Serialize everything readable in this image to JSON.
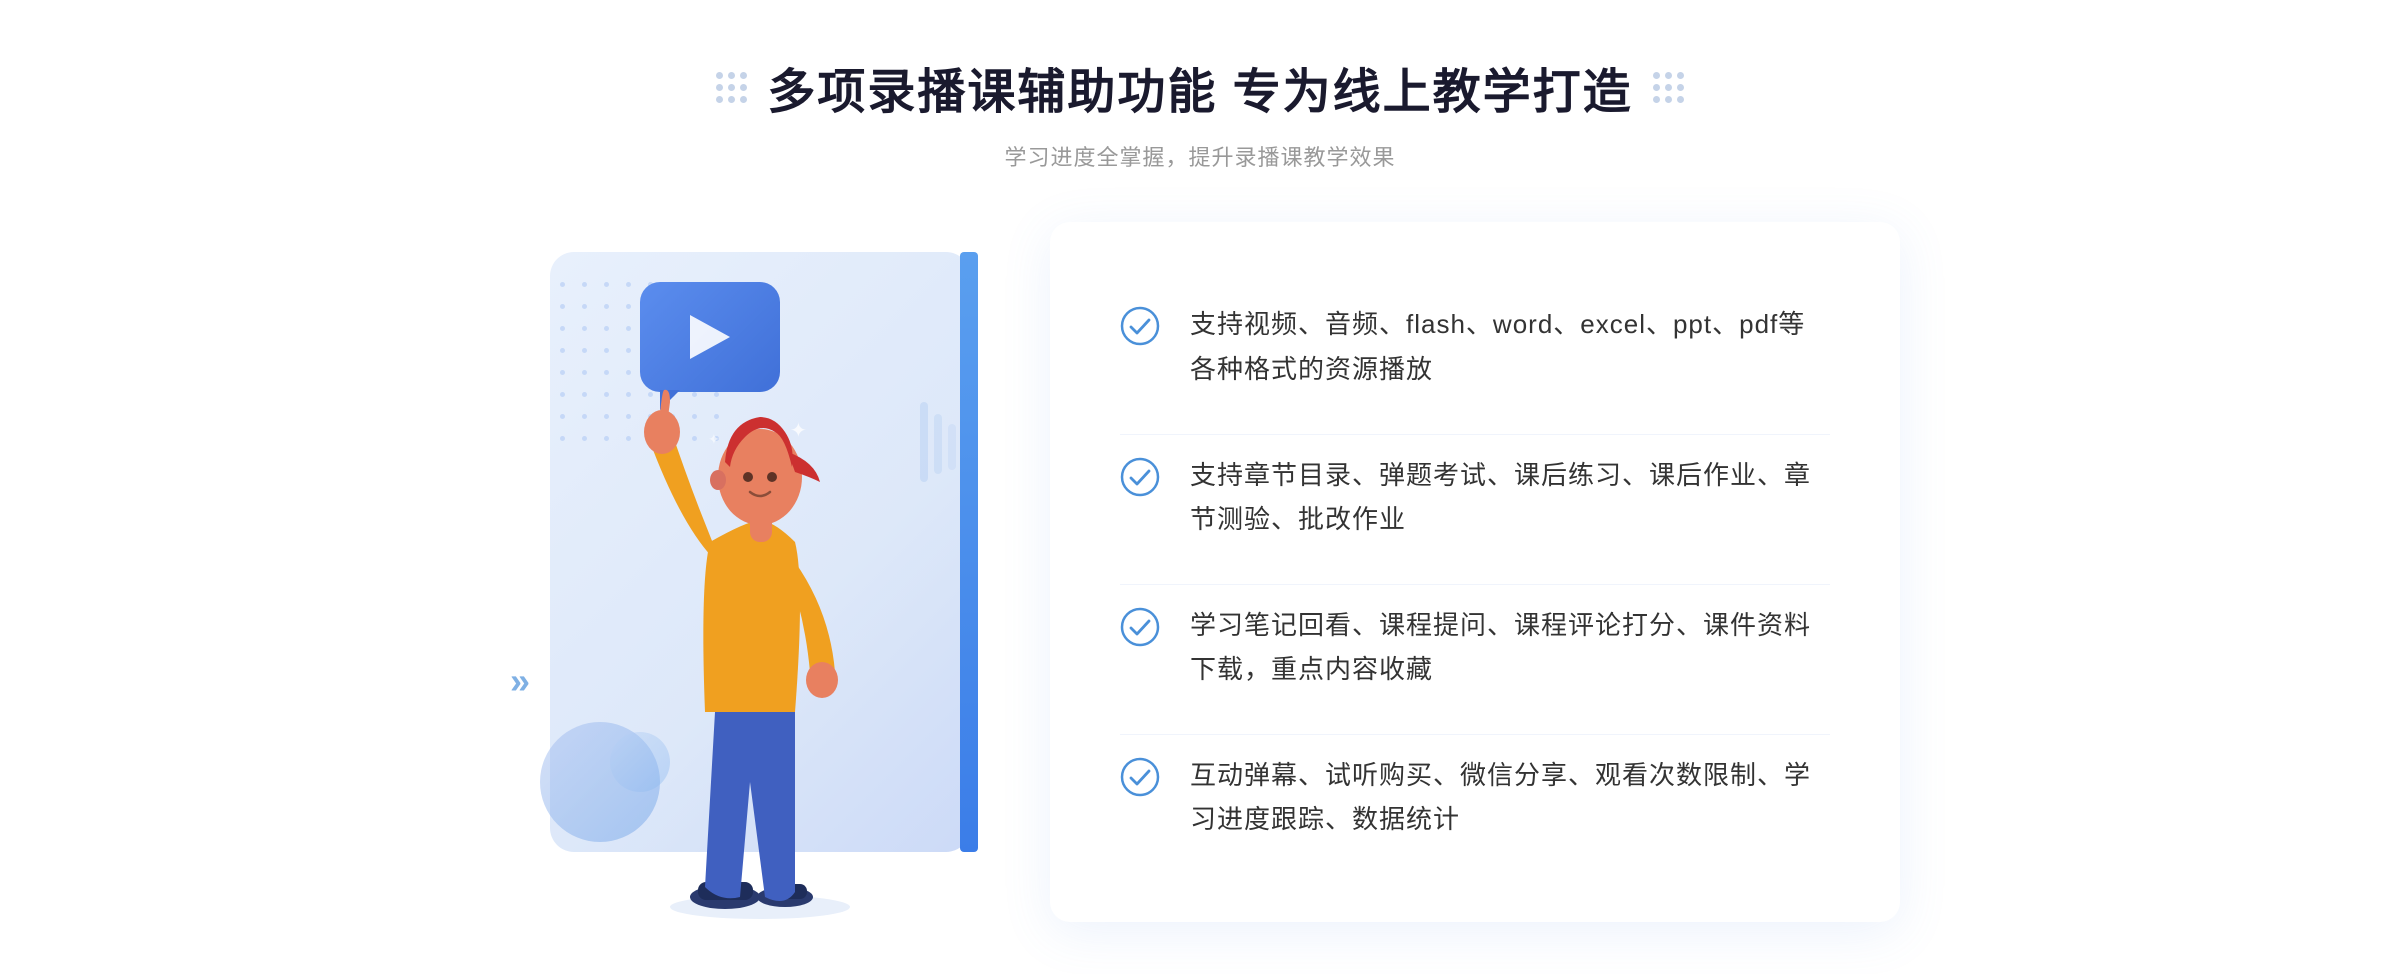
{
  "header": {
    "title": "多项录播课辅助功能 专为线上教学打造",
    "subtitle": "学习进度全掌握，提升录播课教学效果"
  },
  "features": [
    {
      "id": "feature-1",
      "text": "支持视频、音频、flash、word、excel、ppt、pdf等各种格式的资源播放"
    },
    {
      "id": "feature-2",
      "text": "支持章节目录、弹题考试、课后练习、课后作业、章节测验、批改作业"
    },
    {
      "id": "feature-3",
      "text": "学习笔记回看、课程提问、课程评论打分、课件资料下载，重点内容收藏"
    },
    {
      "id": "feature-4",
      "text": "互动弹幕、试听购买、微信分享、观看次数限制、学习进度跟踪、数据统计"
    }
  ],
  "icons": {
    "check": "check-circle-icon",
    "play": "play-icon",
    "dots_left": "decorative-dots-left",
    "dots_right": "decorative-dots-right",
    "chevrons": "chevrons-left-icon"
  },
  "colors": {
    "accent_blue": "#4080e8",
    "light_blue": "#6fa3ef",
    "title_color": "#1a1a2e",
    "text_color": "#333333",
    "subtitle_color": "#999999",
    "check_color": "#4a90d9"
  }
}
